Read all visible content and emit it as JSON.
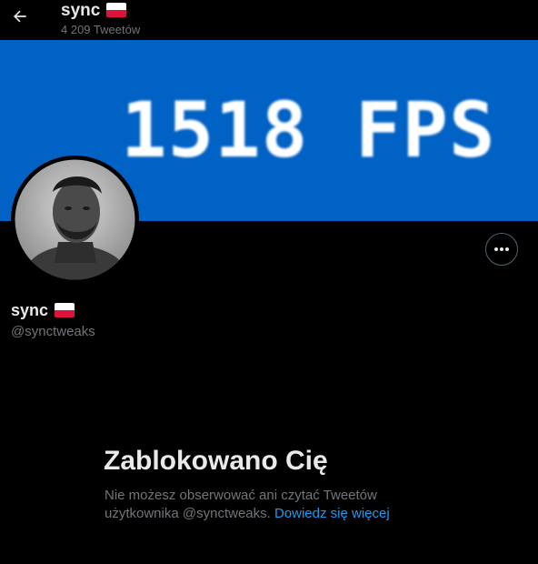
{
  "header": {
    "name": "sync",
    "tweet_count": "4 209 Tweetów"
  },
  "banner": {
    "text": "1518 FPS [|"
  },
  "profile": {
    "name": "sync",
    "handle": "@synctweaks"
  },
  "blocked": {
    "title": "Zablokowano Cię",
    "desc_line1": "Nie możesz obserwować ani czytać Tweetów",
    "desc_line2": "użytkownika @synctweaks.",
    "link": "Dowiedz się więcej"
  },
  "colors": {
    "background": "#000000",
    "banner": "#0062c4",
    "link": "#1d9bf0",
    "secondary_text": "#71767b"
  },
  "icons": [
    "back-arrow-icon",
    "poland-flag-icon",
    "more-options-icon"
  ]
}
